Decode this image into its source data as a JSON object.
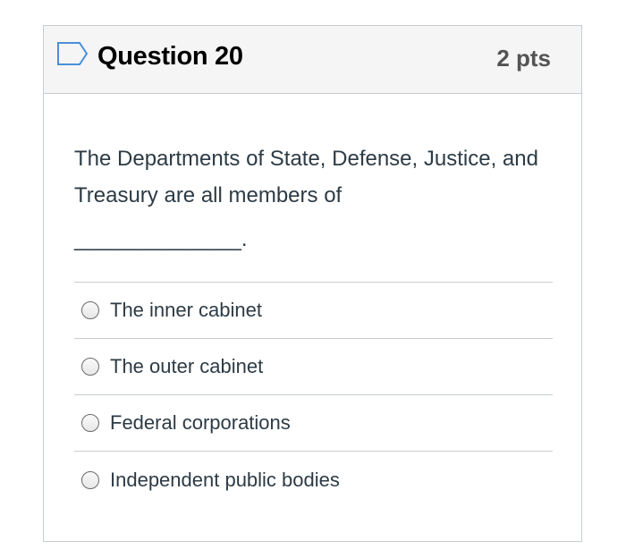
{
  "question": {
    "title": "Question 20",
    "points": "2 pts",
    "text": "The Departments of State, Defense, Justice, and Treasury are all members of",
    "blank": "______________."
  },
  "answers": [
    {
      "label": "The inner cabinet",
      "selected": false
    },
    {
      "label": "The outer cabinet",
      "selected": false
    },
    {
      "label": "Federal corporations",
      "selected": false
    },
    {
      "label": "Independent public bodies",
      "selected": false
    }
  ],
  "colors": {
    "header_bg": "#f5f5f5",
    "border": "#c7cdd1",
    "flag_icon": "#4a8fd8",
    "text": "#2d3b45"
  },
  "icons": {
    "flag": "flag-outline-icon"
  }
}
